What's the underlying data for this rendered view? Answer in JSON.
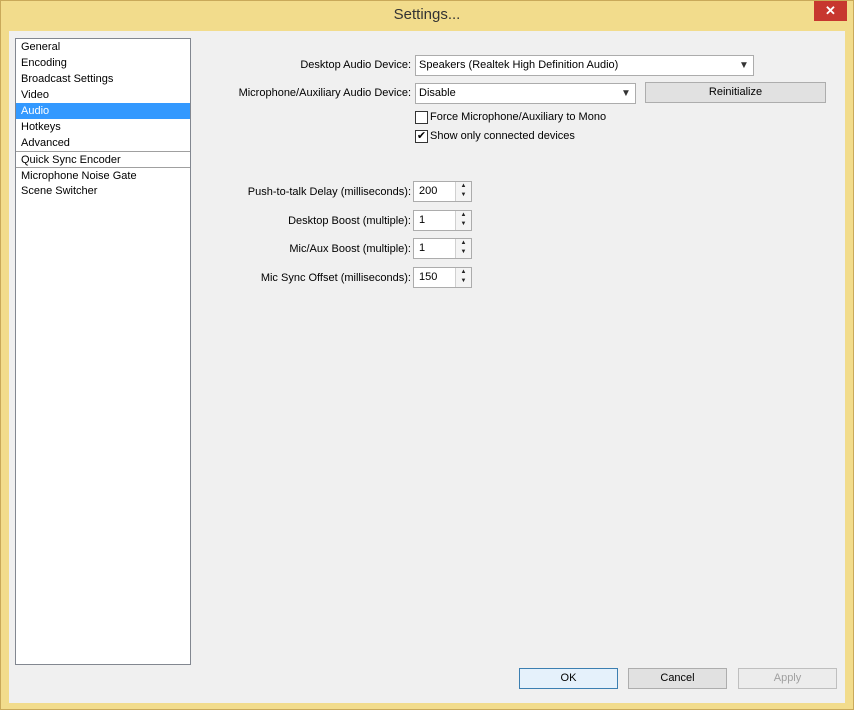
{
  "window": {
    "title": "Settings...",
    "close": "✕"
  },
  "sidebar": {
    "items": [
      {
        "label": "General"
      },
      {
        "label": "Encoding"
      },
      {
        "label": "Broadcast Settings"
      },
      {
        "label": "Video"
      },
      {
        "label": "Audio",
        "selected": true
      },
      {
        "label": "Hotkeys"
      },
      {
        "label": "Advanced"
      },
      {
        "label": "Quick Sync Encoder"
      },
      {
        "label": "Microphone Noise Gate"
      },
      {
        "label": "Scene Switcher"
      }
    ]
  },
  "audio": {
    "desktop_device_label": "Desktop Audio Device:",
    "desktop_device_value": "Speakers (Realtek High Definition Audio)",
    "mic_device_label": "Microphone/Auxiliary Audio Device:",
    "mic_device_value": "Disable",
    "reinitialize_label": "Reinitialize",
    "force_mono_label": "Force Microphone/Auxiliary to Mono",
    "force_mono_checked": false,
    "show_connected_label": "Show only connected devices",
    "show_connected_checked": true,
    "ptt_delay_label": "Push-to-talk Delay (milliseconds):",
    "ptt_delay_value": "200",
    "desktop_boost_label": "Desktop Boost (multiple):",
    "desktop_boost_value": "1",
    "mic_boost_label": "Mic/Aux Boost (multiple):",
    "mic_boost_value": "1",
    "mic_sync_label": "Mic Sync Offset (milliseconds):",
    "mic_sync_value": "150"
  },
  "footer": {
    "ok_label": "OK",
    "cancel_label": "Cancel",
    "apply_label": "Apply"
  },
  "icons": {
    "dropdown": "chevron-down-icon",
    "check": "checkmark-icon",
    "spin_up": "triangle-up-icon",
    "spin_down": "triangle-down-icon"
  }
}
